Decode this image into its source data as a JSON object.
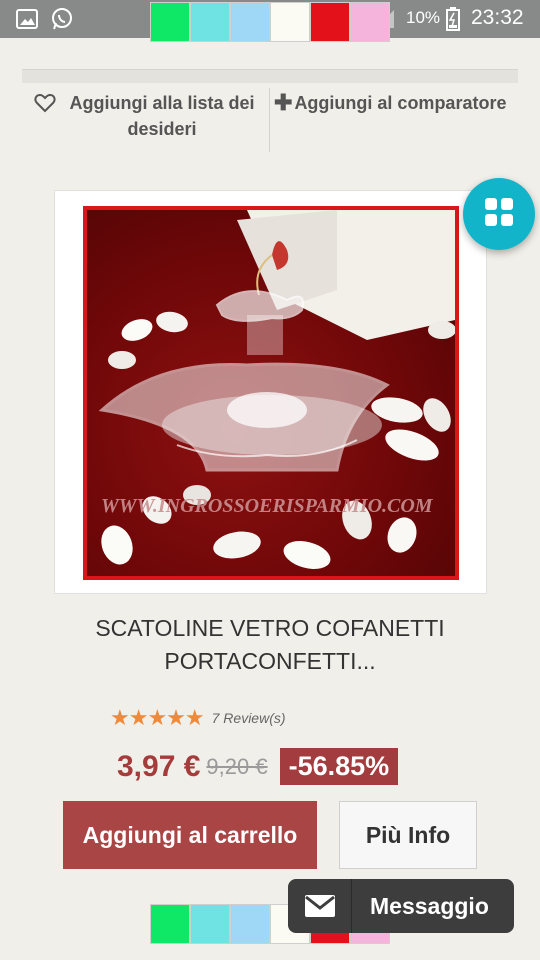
{
  "status_bar": {
    "battery": "10%",
    "time": "23:32"
  },
  "colors": {
    "swatches": [
      "#0ee866",
      "#6fe3e3",
      "#9fd7f7",
      "#fbfbf4",
      "#e3121a",
      "#f5b4dc"
    ],
    "accent": "#a94545",
    "fab": "#12b4c9"
  },
  "actions": {
    "wishlist_label": "Aggiungi alla lista dei desideri",
    "compare_label": "Aggiungi al comparatore"
  },
  "product": {
    "image_watermark": "WWW.INGROSSOERISPARMIO.COM",
    "title_line1": "SCATOLINE VETRO COFANETTI",
    "title_line2": "PORTACONFETTI...",
    "rating_stars": 5,
    "reviews": "7 Review(s)",
    "price": "3,97 €",
    "old_price": "9,20 €",
    "discount": "-56.85%"
  },
  "buttons": {
    "add_to_cart": "Aggiungi al carrello",
    "more_info": "Più Info"
  },
  "message_widget": {
    "label": "Messaggio"
  }
}
